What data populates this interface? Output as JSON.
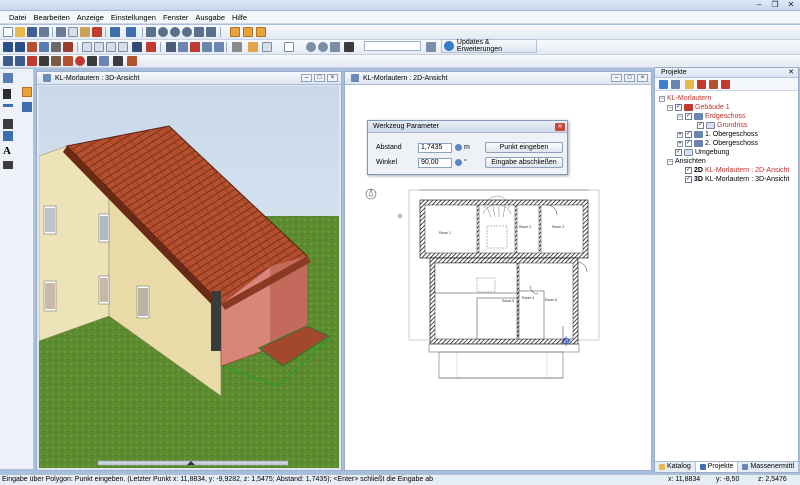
{
  "menu": [
    "Datei",
    "Bearbeiten",
    "Anzeige",
    "Einstellungen",
    "Fenster",
    "Ausgabe",
    "Hilfe"
  ],
  "toolbar": {
    "updates_label": "Updates & Erweiterungen"
  },
  "views": {
    "view3d": {
      "title": "KL-Morlautern : 3D-Ansicht"
    },
    "view2d": {
      "title": "KL-Morlautern : 2D-Ansicht"
    }
  },
  "dialog": {
    "title": "Werkzeug Parameter",
    "abstand_label": "Abstand",
    "abstand_value": "1,7435",
    "abstand_unit": "m",
    "winkel_label": "Winkel",
    "winkel_value": "90,00",
    "winkel_unit": "°",
    "btn_punkt": "Punkt eingeben",
    "btn_abschliessen": "Eingabe abschließen"
  },
  "plan_labels": {
    "r1": "Raum 1",
    "r2": "Raum 2",
    "r3": "Raum 3",
    "r4": "Raum 4",
    "r5": "Raum 5",
    "r6": "Raum 6"
  },
  "projects": {
    "header": "Projekte",
    "tree": {
      "root": "KL-Morlautern",
      "building": "Gebäude 1",
      "eg": "Erdgeschoss",
      "grundriss": "Grundriss",
      "og1": "1. Obergeschoss",
      "og2": "2. Obergeschoss",
      "umgebung": "Umgebung",
      "ansichten": "Ansichten",
      "v2d_tag": "2D",
      "v2d": "KL-Morlautern : 2D-Ansicht",
      "v3d_tag": "3D",
      "v3d": "KL-Morlautern : 3D-Ansicht"
    },
    "tabs": [
      "Katalog",
      "Projekte",
      "Massenermittl"
    ]
  },
  "status": {
    "message": "Eingabe über Polygon: Punkt eingeben. (Letzter Punkt x: 11,8834, y: -9,9282, z: 1,5475; Abstand: 1,7435); <Enter> schließt die Eingabe ab",
    "x": "x: 11,8834",
    "y": "y: -8,50",
    "z": "z: 2,5476"
  },
  "colors": {
    "accent": "#c2302a",
    "roof": "#b5502f",
    "grass": "#5c8a2e"
  }
}
